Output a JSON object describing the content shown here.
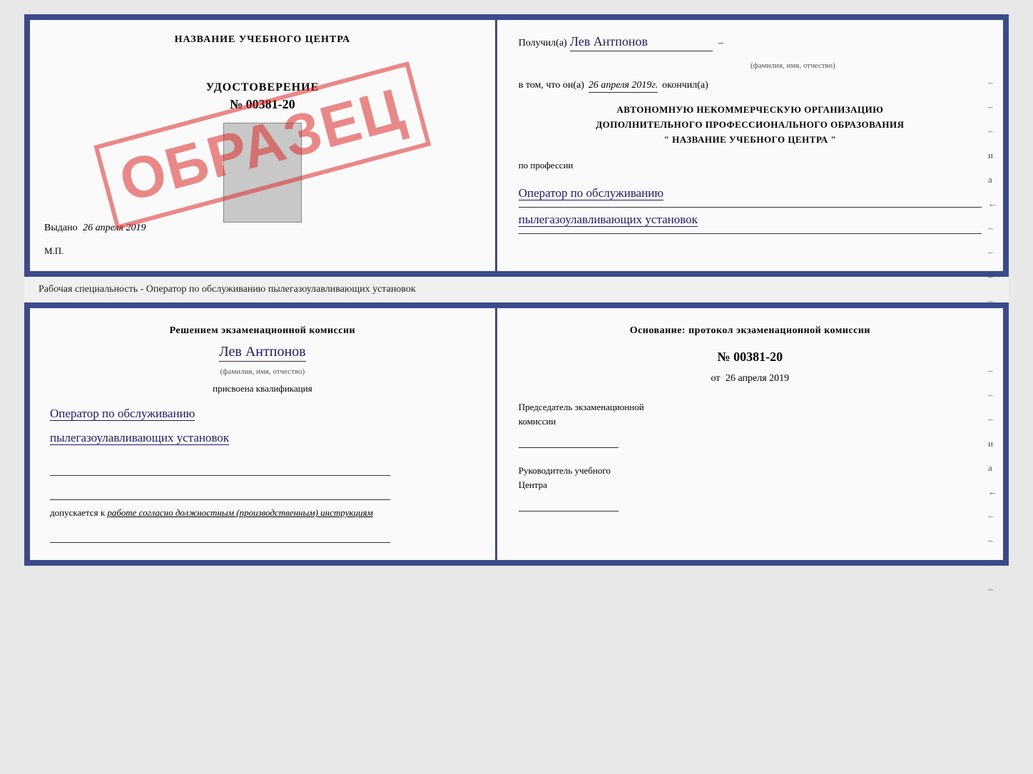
{
  "top_cert": {
    "left": {
      "title": "НАЗВАНИЕ УЧЕБНОГО ЦЕНТРА",
      "stamp": "ОБРАЗЕЦ",
      "udostoverenie_label": "УДОСТОВЕРЕНИЕ",
      "udostoverenie_number": "№ 00381-20",
      "vydano_label": "Выдано",
      "vydano_date": "26 апреля 2019",
      "mp_label": "М.П."
    },
    "right": {
      "poluchil_label": "Получил(а)",
      "poluchil_name": "Лев Антпонов",
      "fio_label": "(фамилия, имя, отчество)",
      "dash": "–",
      "vtom_label": "в том, что он(а)",
      "date_value": "26 апреля 2019г.",
      "okonchil_label": "окончил(а)",
      "org_line1": "АВТОНОМНУЮ НЕКОММЕРЧЕСКУЮ ОРГАНИЗАЦИЮ",
      "org_line2": "ДОПОЛНИТЕЛЬНОГО ПРОФЕССИОНАЛЬНОГО ОБРАЗОВАНИЯ",
      "org_line3": "\"   НАЗВАНИЕ УЧЕБНОГО ЦЕНТРА   \"",
      "po_professii_label": "по профессии",
      "profession_line1": "Оператор по обслуживанию",
      "profession_line2": "пылегазоулавливающих установок",
      "side_dashes": [
        "–",
        "–",
        "–",
        "и",
        "а",
        "←",
        "–",
        "–",
        "–",
        "–"
      ]
    }
  },
  "separator": {
    "text": "Рабочая специальность - Оператор по обслуживанию пылегазоулавливающих установок"
  },
  "bottom_cert": {
    "left": {
      "resheniem_label": "Решением экзаменационной комиссии",
      "person_name": "Лев Антпонов",
      "fio_label": "(фамилия, имя, отчество)",
      "prisvoena_label": "присвоена квалификация",
      "qualification_line1": "Оператор по обслуживанию",
      "qualification_line2": "пылегазоулавливающих установок",
      "dopuskaetsya_label": "допускается к",
      "dopusk_text": "работе согласно должностным (производственным) инструкциям"
    },
    "right": {
      "osnovaniye_label": "Основание: протокол экзаменационной комиссии",
      "protocol_number": "№ 00381-20",
      "ot_label": "от",
      "ot_date": "26 апреля 2019",
      "predsedatel_line1": "Председатель экзаменационной",
      "predsedatel_line2": "комиссии",
      "rukovoditel_line1": "Руководитель учебного",
      "rukovoditel_line2": "Центра",
      "side_dashes": [
        "–",
        "–",
        "–",
        "и",
        "а",
        "←",
        "–",
        "–",
        "–",
        "–"
      ]
    }
  }
}
